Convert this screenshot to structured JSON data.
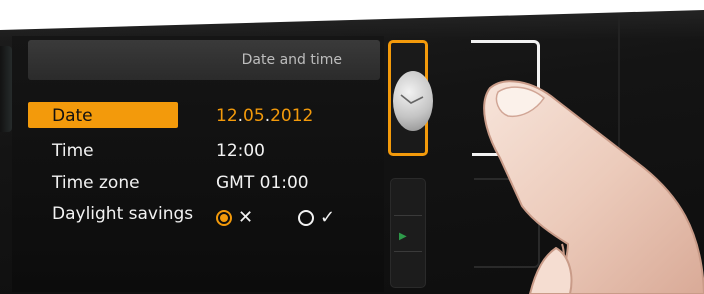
{
  "header": {
    "title": "Date and time"
  },
  "settings": {
    "rows": [
      {
        "label": "Date",
        "value_day": "12",
        "value_month": "05",
        "value_year": "2012",
        "separator": "."
      },
      {
        "label": "Time",
        "value": "12:00"
      },
      {
        "label": "Time zone",
        "value": "GMT 01:00"
      },
      {
        "label": "Daylight savings",
        "option_off_glyph": "✕",
        "option_on_glyph": "✓",
        "selected": "off"
      }
    ]
  },
  "side_rail": {
    "active_button_icon": "clock-icon",
    "inactive_button_icon": "settings-rail-icon"
  },
  "colors": {
    "accent": "#f39a0b",
    "text": "#f2f2f2",
    "header_text": "#bdbdbd",
    "background": "#111111"
  }
}
